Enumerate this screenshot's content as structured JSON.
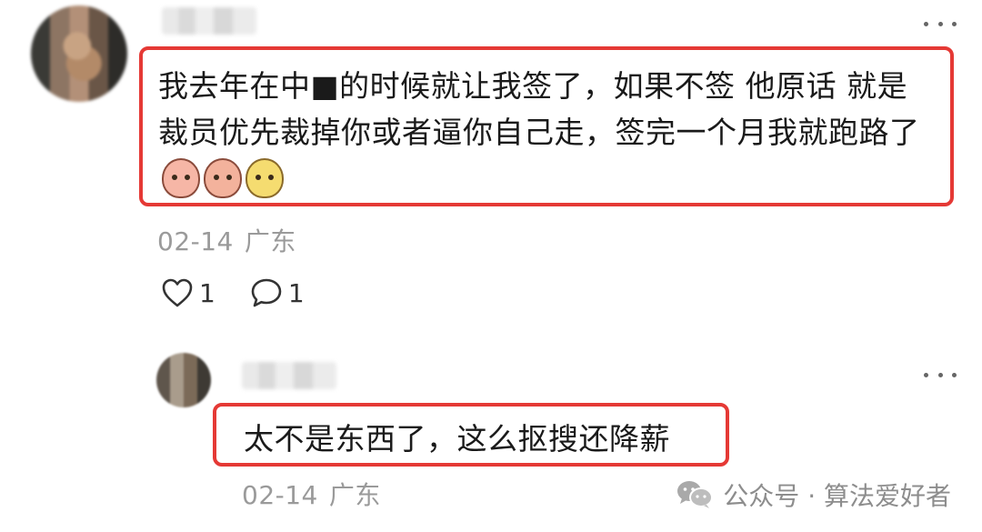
{
  "comment": {
    "text": "我去年在中■的时候就让我签了，如果不签 他原话 就是 裁员优先裁掉你或者逼你自己走，签完一个月我就跑路了",
    "emojis": [
      "crying-emoji",
      "covering-face-emoji",
      "pear-emoji"
    ],
    "date": "02-14",
    "location": "广东",
    "likes": "1",
    "replies": "1"
  },
  "reply": {
    "text": "太不是东西了，这么抠搜还降薪",
    "date": "02-14",
    "location": "广东"
  },
  "watermark": {
    "text": "公众号 · 算法爱好者",
    "icon": "wechat-icon"
  },
  "colors": {
    "highlight": "#e53935",
    "meta": "#9a9a9a"
  }
}
